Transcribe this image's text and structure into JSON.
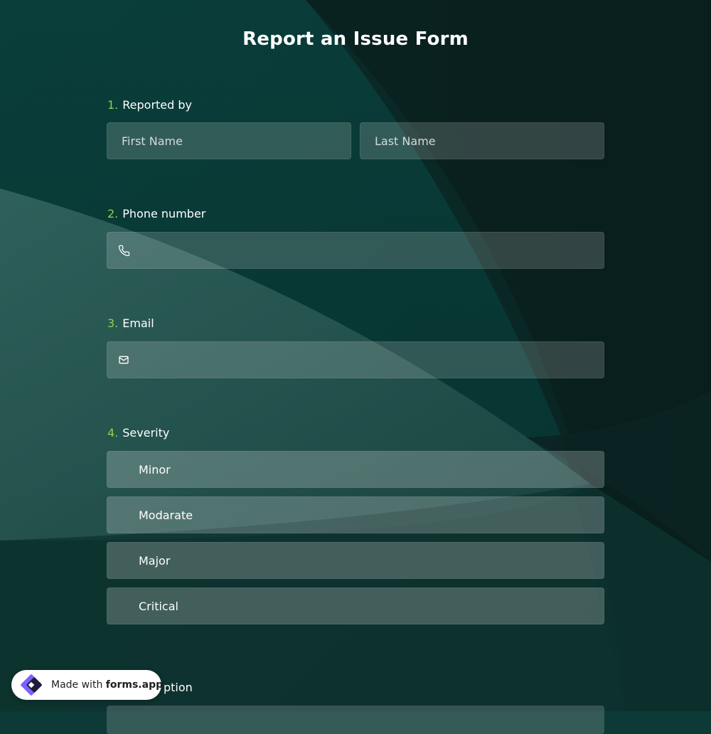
{
  "form": {
    "title": "Report an Issue Form",
    "accent_color": "#8fd14f",
    "questions": [
      {
        "number": "1.",
        "label": "Reported by",
        "inputs": [
          {
            "placeholder": "First Name"
          },
          {
            "placeholder": "Last Name"
          }
        ]
      },
      {
        "number": "2.",
        "label": "Phone number",
        "icon": "phone-icon"
      },
      {
        "number": "3.",
        "label": "Email",
        "icon": "mail-icon"
      },
      {
        "number": "4.",
        "label": "Severity",
        "options": [
          "Minor",
          "Modarate",
          "Major",
          "Critical"
        ]
      },
      {
        "label_partial": "ption"
      }
    ]
  },
  "badge": {
    "prefix": "Made with ",
    "brand": "forms.app",
    "logo_icon": "forms-app-logo-icon"
  }
}
